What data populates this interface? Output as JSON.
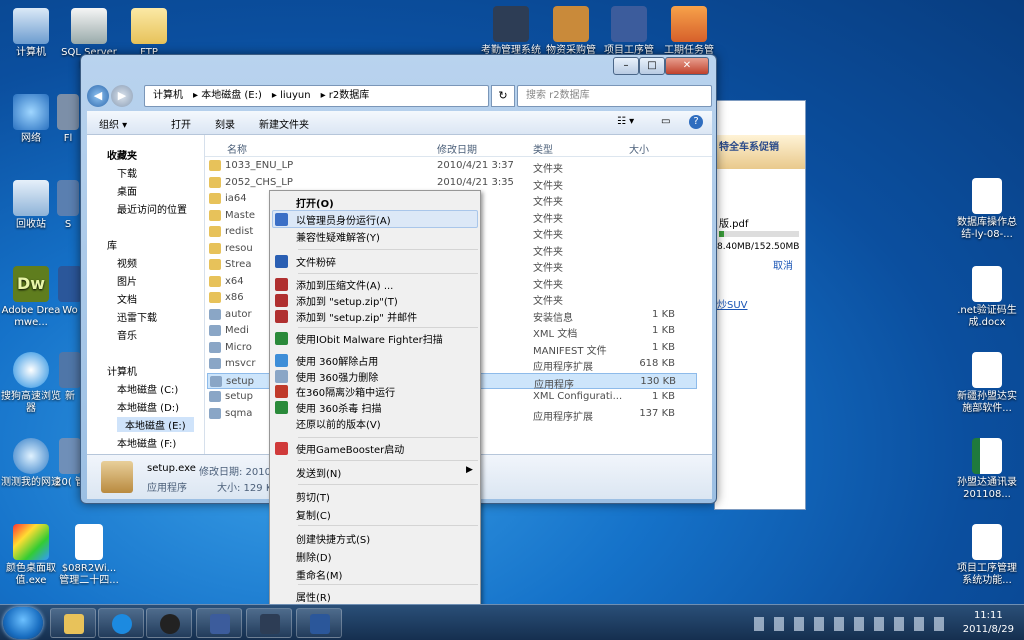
{
  "desktop_icons_left": [
    "计算机",
    "SQL Server M...",
    "FTP",
    "网络",
    "Fl",
    "回收站",
    "S",
    "Adobe Dreamwe...",
    "Wo",
    "搜狗高速浏览器",
    "新",
    "测测我的网速",
    "20( 管",
    "颜色桌面取值.exe",
    "$08R2Wi... 管理二十四..."
  ],
  "desktop_icons_top": [
    "考勤管理系统",
    "物资采购管",
    "项目工序管",
    "工期任务管"
  ],
  "desktop_icons_right": [
    "数据库操作总结-ly-08-...",
    ".net验证码生成.docx",
    "新疆孙盟达实施部软件...",
    "孙盟达通讯录201108...",
    "项目工序管理系统功能..."
  ],
  "explorer": {
    "address": [
      "计算机",
      "本地磁盘 (E:)",
      "liuyun",
      "r2数据库"
    ],
    "search_placeholder": "搜索 r2数据库",
    "toolbar": [
      "组织 ▾",
      "打开",
      "刻录",
      "新建文件夹"
    ],
    "nav": [
      {
        "label": "收藏夹"
      },
      {
        "label": "下载"
      },
      {
        "label": "桌面"
      },
      {
        "label": "最近访问的位置"
      },
      {
        "label": "库"
      },
      {
        "label": "视频"
      },
      {
        "label": "图片"
      },
      {
        "label": "文档"
      },
      {
        "label": "迅雷下载"
      },
      {
        "label": "音乐"
      },
      {
        "label": "计算机"
      },
      {
        "label": "本地磁盘 (C:)"
      },
      {
        "label": "本地磁盘 (D:)"
      },
      {
        "label": "本地磁盘 (E:)"
      },
      {
        "label": "本地磁盘 (F:)"
      }
    ],
    "columns": [
      "名称",
      "修改日期",
      "类型",
      "大小"
    ],
    "rows": [
      [
        "1033_ENU_LP",
        "2010/4/21 3:37",
        "文件夹",
        ""
      ],
      [
        "2052_CHS_LP",
        "2010/4/21 3:35",
        "文件夹",
        ""
      ],
      [
        "ia64",
        "3:40",
        "文件夹",
        ""
      ],
      [
        "Maste",
        "3:35",
        "文件夹",
        ""
      ],
      [
        "redist",
        "3:38",
        "文件夹",
        ""
      ],
      [
        "resou",
        "3:35",
        "文件夹",
        ""
      ],
      [
        "Strea",
        "3:35",
        "文件夹",
        ""
      ],
      [
        "x64",
        "3:40",
        "文件夹",
        ""
      ],
      [
        "x86",
        "3:39",
        "文件夹",
        ""
      ],
      [
        "autor",
        "17:21",
        "安装信息",
        "1 KB"
      ],
      [
        "Medi",
        "7:53",
        "XML 文档",
        "1 KB"
      ],
      [
        "Micro",
        "19:07",
        "MANIFEST 文件",
        "1 KB"
      ],
      [
        "msvcr",
        "19:09",
        "应用程序扩展",
        "618 KB"
      ],
      [
        "setup",
        "2:56",
        "应用程序",
        "130 KB"
      ],
      [
        "setup",
        "14:52",
        "XML Configurati...",
        "1 KB"
      ],
      [
        "sqma",
        "2:47",
        "应用程序扩展",
        "137 KB"
      ]
    ],
    "details": {
      "name": "setup.exe",
      "modified": "修改日期: 2010/",
      "type": "应用程序",
      "size": "大小: 129 K"
    }
  },
  "context_menu": [
    "打开(O)",
    "以管理员身份运行(A)",
    "兼容性疑难解答(Y)",
    "文件粉碎",
    "添加到压缩文件(A) ...",
    "添加到 \"setup.zip\"(T)",
    "添加到 \"setup.zip\" 并邮件",
    "使用IObit Malware Fighter扫描",
    "使用 360解除占用",
    "使用 360强力删除",
    "在360隔离沙箱中运行",
    "使用 360杀毒 扫描",
    "还原以前的版本(V)",
    "使用GameBooster启动",
    "发送到(N)",
    "剪切(T)",
    "复制(C)",
    "创建快捷方式(S)",
    "删除(D)",
    "重命名(M)",
    "属性(R)"
  ],
  "right_panel": {
    "banner": "特全车系促销",
    "file": "版.pdf",
    "progress": "8.40MB/152.50MB",
    "cancel": "取消",
    "link": "炒SUV"
  },
  "clock": {
    "time": "11:11",
    "date": "2011/8/29"
  }
}
